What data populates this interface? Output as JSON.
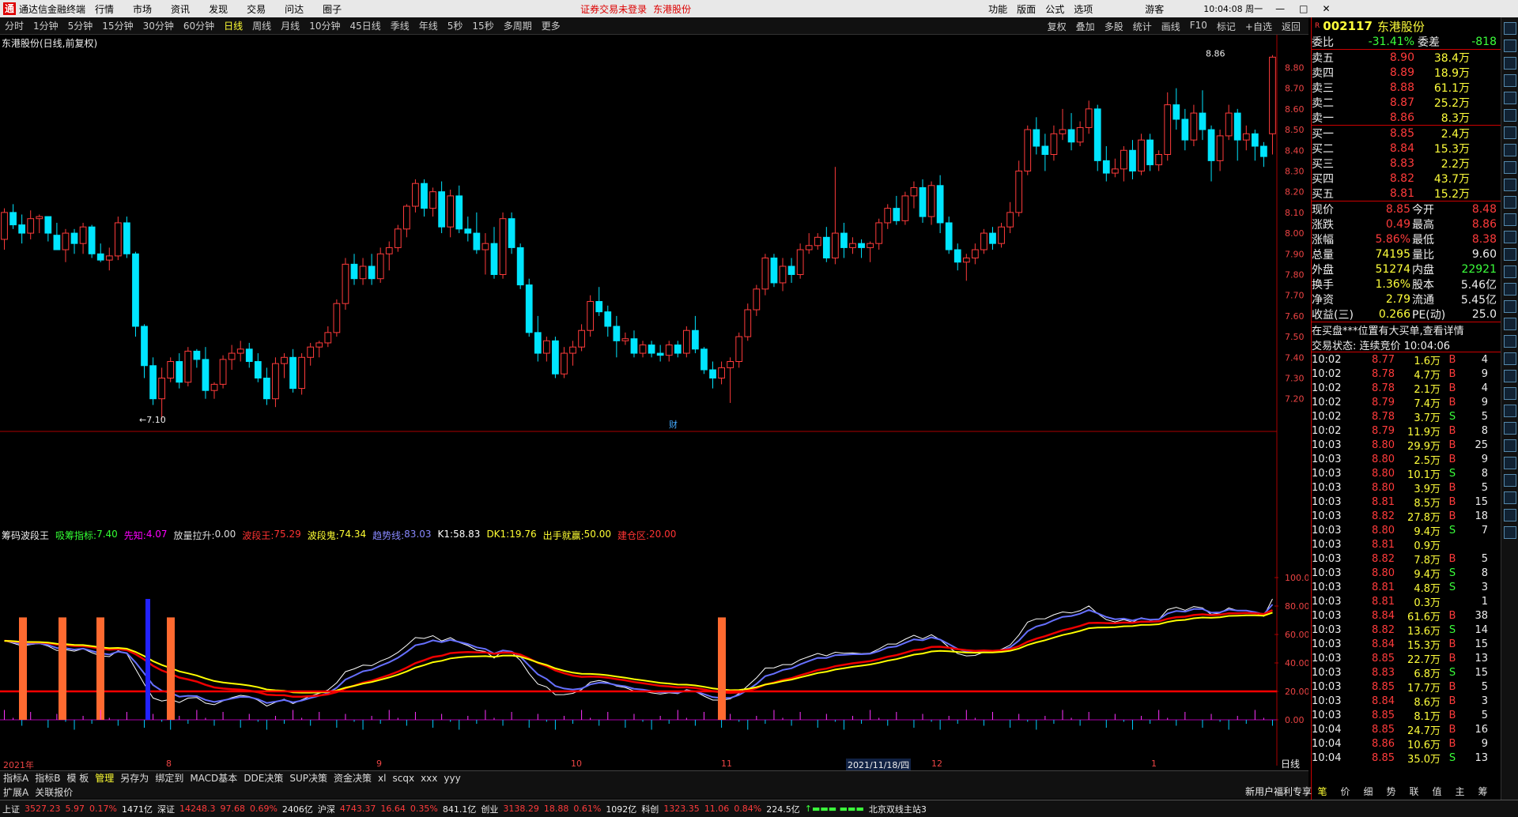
{
  "window": {
    "app_title": "通达信金融终端",
    "menus": [
      "行情",
      "市场",
      "资讯",
      "发现",
      "交易",
      "问达",
      "圈子"
    ],
    "notice": "证券交易未登录",
    "notice_stock": "东港股份",
    "right_menus": [
      "功能",
      "版面",
      "公式",
      "选项"
    ],
    "user": "游客",
    "clock": "10:04:08 周一"
  },
  "periods": [
    "分时",
    "1分钟",
    "5分钟",
    "15分钟",
    "30分钟",
    "60分钟",
    "日线",
    "周线",
    "月线",
    "10分钟",
    "45日线",
    "季线",
    "年线",
    "5秒",
    "15秒",
    "多周期",
    "更多"
  ],
  "active_period": "日线",
  "chart_tools": [
    "复权",
    "叠加",
    "多股",
    "统计",
    "画线",
    "F10",
    "标记",
    "+自选",
    "返回"
  ],
  "chart_title": "东港股份(日线,前复权)",
  "price_high_label": "8.86",
  "price_low_label": "7.10",
  "cai_label": "财",
  "price_axis": [
    "8.80",
    "8.70",
    "8.60",
    "8.50",
    "8.40",
    "8.30",
    "8.20",
    "8.10",
    "8.00",
    "7.90",
    "7.80",
    "7.70",
    "7.60",
    "7.50",
    "7.40",
    "7.30",
    "7.20"
  ],
  "indicator": {
    "name": "筹码波段王",
    "items": [
      {
        "k": "吸筹指标:",
        "v": "7.40",
        "c": "#3f3"
      },
      {
        "k": "先知:",
        "v": "4.07",
        "c": "#f0f"
      },
      {
        "k": "放量拉升:",
        "v": "0.00",
        "c": "#ddd"
      },
      {
        "k": "波段王:",
        "v": "75.29",
        "c": "#f33"
      },
      {
        "k": "波段鬼:",
        "v": "74.34",
        "c": "#ff3"
      },
      {
        "k": "趋势线:",
        "v": "83.03",
        "c": "#88f"
      },
      {
        "k": "K1:",
        "v": "58.83",
        "c": "#fff"
      },
      {
        "k": "DK1:",
        "v": "19.76",
        "c": "#ff3"
      },
      {
        "k": "出手就赢:",
        "v": "50.00",
        "c": "#ff3"
      },
      {
        "k": "建仓区:",
        "v": "20.00",
        "c": "#f33"
      }
    ]
  },
  "ind_axis": [
    "100.0",
    "80.00",
    "60.00",
    "40.00",
    "20.00",
    "0.00"
  ],
  "date_axis": [
    "2021年",
    "8",
    "9",
    "10",
    "11",
    "12",
    "1"
  ],
  "cursor_date": "2021/11/18/四",
  "period_label": "日线",
  "bottom_tabs": [
    "指标A",
    "指标B",
    "模 板",
    "管理",
    "另存为",
    "绑定到",
    "MACD基本",
    "DDE决策",
    "SUP决策",
    "资金决策",
    "xl",
    "scqx",
    "xxx",
    "yyy"
  ],
  "active_bottom_tab": "管理",
  "tabs2": [
    "扩展A",
    "关联报价"
  ],
  "quote": {
    "code": "002117",
    "name": "东港股份",
    "weibi_label": "委比",
    "weibi": "-31.41%",
    "weicha_label": "委差",
    "weicha": "-818",
    "asks": [
      {
        "l": "卖五",
        "p": "8.90",
        "v": "38.4万"
      },
      {
        "l": "卖四",
        "p": "8.89",
        "v": "18.9万"
      },
      {
        "l": "卖三",
        "p": "8.88",
        "v": "61.1万"
      },
      {
        "l": "卖二",
        "p": "8.87",
        "v": "25.2万"
      },
      {
        "l": "卖一",
        "p": "8.86",
        "v": "8.3万"
      }
    ],
    "bids": [
      {
        "l": "买一",
        "p": "8.85",
        "v": "2.4万"
      },
      {
        "l": "买二",
        "p": "8.84",
        "v": "15.3万"
      },
      {
        "l": "买三",
        "p": "8.83",
        "v": "2.2万"
      },
      {
        "l": "买四",
        "p": "8.82",
        "v": "43.7万"
      },
      {
        "l": "买五",
        "p": "8.81",
        "v": "15.2万"
      }
    ],
    "stats": [
      [
        "现价",
        "8.85",
        "今开",
        "8.48"
      ],
      [
        "涨跌",
        "0.49",
        "最高",
        "8.86"
      ],
      [
        "涨幅",
        "5.86%",
        "最低",
        "8.38"
      ],
      [
        "总量",
        "74195",
        "量比",
        "9.60"
      ],
      [
        "外盘",
        "51274",
        "内盘",
        "22921"
      ],
      [
        "换手",
        "1.36%",
        "股本",
        "5.46亿"
      ],
      [
        "净资",
        "2.79",
        "流通",
        "5.45亿"
      ],
      [
        "收益(三)",
        "0.266",
        "PE(动)",
        "25.0"
      ]
    ],
    "note": "在买盘***位置有大买单,查看详情",
    "status": "交易状态: 连续竞价 10:04:06",
    "ticks": [
      [
        "10:02",
        "8.77",
        "1.6万",
        "B",
        "4"
      ],
      [
        "10:02",
        "8.78",
        "4.7万",
        "B",
        "9"
      ],
      [
        "10:02",
        "8.78",
        "2.1万",
        "B",
        "4"
      ],
      [
        "10:02",
        "8.79",
        "7.4万",
        "B",
        "9"
      ],
      [
        "10:02",
        "8.78",
        "3.7万",
        "S",
        "5"
      ],
      [
        "10:02",
        "8.79",
        "11.9万",
        "B",
        "8"
      ],
      [
        "10:03",
        "8.80",
        "29.9万",
        "B",
        "25"
      ],
      [
        "10:03",
        "8.80",
        "2.5万",
        "B",
        "9"
      ],
      [
        "10:03",
        "8.80",
        "10.1万",
        "S",
        "8"
      ],
      [
        "10:03",
        "8.80",
        "3.9万",
        "B",
        "5"
      ],
      [
        "10:03",
        "8.81",
        "8.5万",
        "B",
        "15"
      ],
      [
        "10:03",
        "8.82",
        "27.8万",
        "B",
        "18"
      ],
      [
        "10:03",
        "8.80",
        "9.4万",
        "S",
        "7"
      ],
      [
        "10:03",
        "8.81",
        "0.9万",
        "",
        ""
      ],
      [
        "10:03",
        "8.82",
        "7.8万",
        "B",
        "5"
      ],
      [
        "10:03",
        "8.80",
        "9.4万",
        "S",
        "8"
      ],
      [
        "10:03",
        "8.81",
        "4.8万",
        "S",
        "3"
      ],
      [
        "10:03",
        "8.81",
        "0.3万",
        "",
        "1"
      ],
      [
        "10:03",
        "8.84",
        "61.6万",
        "B",
        "38"
      ],
      [
        "10:03",
        "8.82",
        "13.6万",
        "S",
        "14"
      ],
      [
        "10:03",
        "8.84",
        "15.3万",
        "B",
        "15"
      ],
      [
        "10:03",
        "8.85",
        "22.7万",
        "B",
        "13"
      ],
      [
        "10:03",
        "8.83",
        "6.8万",
        "S",
        "15"
      ],
      [
        "10:03",
        "8.85",
        "17.7万",
        "B",
        "5"
      ],
      [
        "10:03",
        "8.84",
        "8.6万",
        "B",
        "3"
      ],
      [
        "10:03",
        "8.85",
        "8.1万",
        "B",
        "5"
      ],
      [
        "10:04",
        "8.85",
        "24.7万",
        "B",
        "16"
      ],
      [
        "10:04",
        "8.86",
        "10.6万",
        "B",
        "9"
      ],
      [
        "10:04",
        "8.85",
        "35.0万",
        "S",
        "13"
      ]
    ]
  },
  "quote_tabs": [
    "笔",
    "价",
    "细",
    "势",
    "联",
    "值",
    "主",
    "筹"
  ],
  "status": [
    {
      "n": "上证",
      "p": "3527.23",
      "c": "5.97",
      "r": "0.17%",
      "v": "1471亿"
    },
    {
      "n": "深证",
      "p": "14248.3",
      "c": "97.68",
      "r": "0.69%",
      "v": "2406亿"
    },
    {
      "n": "沪深",
      "p": "4743.37",
      "c": "16.64",
      "r": "0.35%",
      "v": "841.1亿"
    },
    {
      "n": "创业",
      "p": "3138.29",
      "c": "18.88",
      "r": "0.61%",
      "v": "1092亿"
    },
    {
      "n": "科创",
      "p": "1323.35",
      "c": "11.06",
      "r": "0.84%",
      "v": "224.5亿"
    }
  ],
  "server": "北京双线主站3",
  "welfare": "新用户福利专享",
  "candles": [
    [
      7.97,
      8.12,
      7.92,
      8.1
    ],
    [
      8.1,
      8.14,
      8.02,
      8.04
    ],
    [
      8.04,
      8.09,
      7.95,
      8.0
    ],
    [
      8.0,
      8.11,
      7.97,
      8.07
    ],
    [
      8.07,
      8.09,
      8.0,
      8.08
    ],
    [
      8.08,
      8.08,
      7.96,
      8.0
    ],
    [
      7.99,
      8.05,
      7.92,
      7.92
    ],
    [
      7.92,
      8.02,
      7.86,
      8.0
    ],
    [
      8.0,
      8.02,
      7.9,
      7.95
    ],
    [
      7.95,
      8.05,
      7.9,
      8.03
    ],
    [
      8.03,
      8.04,
      7.88,
      7.9
    ],
    [
      7.9,
      7.95,
      7.86,
      7.87
    ],
    [
      7.87,
      7.93,
      7.82,
      7.89
    ],
    [
      7.89,
      8.08,
      7.87,
      8.05
    ],
    [
      8.05,
      8.08,
      7.88,
      7.9
    ],
    [
      7.9,
      7.91,
      7.5,
      7.55
    ],
    [
      7.55,
      7.56,
      7.3,
      7.36
    ],
    [
      7.36,
      7.4,
      7.17,
      7.2
    ],
    [
      7.2,
      7.35,
      7.1,
      7.3
    ],
    [
      7.3,
      7.4,
      7.28,
      7.38
    ],
    [
      7.38,
      7.42,
      7.25,
      7.28
    ],
    [
      7.28,
      7.45,
      7.26,
      7.43
    ],
    [
      7.43,
      7.44,
      7.35,
      7.39
    ],
    [
      7.39,
      7.45,
      7.2,
      7.24
    ],
    [
      7.24,
      7.28,
      7.2,
      7.27
    ],
    [
      7.27,
      7.41,
      7.25,
      7.39
    ],
    [
      7.39,
      7.46,
      7.34,
      7.42
    ],
    [
      7.42,
      7.48,
      7.38,
      7.44
    ],
    [
      7.44,
      7.47,
      7.35,
      7.38
    ],
    [
      7.38,
      7.42,
      7.28,
      7.3
    ],
    [
      7.3,
      7.35,
      7.17,
      7.2
    ],
    [
      7.2,
      7.4,
      7.16,
      7.37
    ],
    [
      7.37,
      7.42,
      7.3,
      7.4
    ],
    [
      7.4,
      7.44,
      7.23,
      7.25
    ],
    [
      7.25,
      7.42,
      7.22,
      7.4
    ],
    [
      7.4,
      7.47,
      7.36,
      7.45
    ],
    [
      7.45,
      7.48,
      7.4,
      7.47
    ],
    [
      7.47,
      7.55,
      7.45,
      7.52
    ],
    [
      7.52,
      7.68,
      7.5,
      7.66
    ],
    [
      7.66,
      7.88,
      7.63,
      7.85
    ],
    [
      7.85,
      7.9,
      7.75,
      7.78
    ],
    [
      7.78,
      7.88,
      7.75,
      7.84
    ],
    [
      7.84,
      7.9,
      7.75,
      7.78
    ],
    [
      7.78,
      7.93,
      7.76,
      7.9
    ],
    [
      7.9,
      7.96,
      7.82,
      7.93
    ],
    [
      7.93,
      8.04,
      7.91,
      8.02
    ],
    [
      8.02,
      8.14,
      7.98,
      8.13
    ],
    [
      8.13,
      8.26,
      8.1,
      8.24
    ],
    [
      8.24,
      8.26,
      8.08,
      8.12
    ],
    [
      8.12,
      8.22,
      8.08,
      8.2
    ],
    [
      8.2,
      8.25,
      8.0,
      8.03
    ],
    [
      8.03,
      8.21,
      7.98,
      8.18
    ],
    [
      8.18,
      8.23,
      8.0,
      8.02
    ],
    [
      8.02,
      8.08,
      7.96,
      8.0
    ],
    [
      8.0,
      8.1,
      7.9,
      7.92
    ],
    [
      7.92,
      8.0,
      7.8,
      7.95
    ],
    [
      7.95,
      8.03,
      7.78,
      7.8
    ],
    [
      7.8,
      8.1,
      7.78,
      8.07
    ],
    [
      8.07,
      8.1,
      7.9,
      7.93
    ],
    [
      7.93,
      7.95,
      7.73,
      7.75
    ],
    [
      7.75,
      7.78,
      7.5,
      7.52
    ],
    [
      7.52,
      7.6,
      7.38,
      7.42
    ],
    [
      7.42,
      7.5,
      7.38,
      7.48
    ],
    [
      7.48,
      7.5,
      7.3,
      7.32
    ],
    [
      7.32,
      7.45,
      7.3,
      7.42
    ],
    [
      7.42,
      7.48,
      7.36,
      7.45
    ],
    [
      7.45,
      7.56,
      7.43,
      7.53
    ],
    [
      7.53,
      7.7,
      7.5,
      7.67
    ],
    [
      7.67,
      7.74,
      7.6,
      7.62
    ],
    [
      7.62,
      7.65,
      7.5,
      7.55
    ],
    [
      7.55,
      7.6,
      7.4,
      7.48
    ],
    [
      7.48,
      7.52,
      7.46,
      7.49
    ],
    [
      7.49,
      7.53,
      7.4,
      7.42
    ],
    [
      7.42,
      7.48,
      7.4,
      7.46
    ],
    [
      7.46,
      7.48,
      7.4,
      7.42
    ],
    [
      7.42,
      7.46,
      7.38,
      7.41
    ],
    [
      7.41,
      7.48,
      7.38,
      7.46
    ],
    [
      7.46,
      7.48,
      7.4,
      7.42
    ],
    [
      7.42,
      7.55,
      7.4,
      7.53
    ],
    [
      7.53,
      7.6,
      7.42,
      7.44
    ],
    [
      7.44,
      7.45,
      7.32,
      7.34
    ],
    [
      7.34,
      7.38,
      7.25,
      7.3
    ],
    [
      7.3,
      7.38,
      7.27,
      7.35
    ],
    [
      7.35,
      7.4,
      7.18,
      7.38
    ],
    [
      7.38,
      7.52,
      7.35,
      7.5
    ],
    [
      7.5,
      7.66,
      7.48,
      7.63
    ],
    [
      7.63,
      7.75,
      7.6,
      7.73
    ],
    [
      7.73,
      7.9,
      7.7,
      7.88
    ],
    [
      7.88,
      7.9,
      7.74,
      7.76
    ],
    [
      7.76,
      7.88,
      7.72,
      7.84
    ],
    [
      7.84,
      7.88,
      7.76,
      7.8
    ],
    [
      7.8,
      7.95,
      7.78,
      7.92
    ],
    [
      7.92,
      8.0,
      7.9,
      7.94
    ],
    [
      7.94,
      8.0,
      7.92,
      7.98
    ],
    [
      7.98,
      8.03,
      7.86,
      7.88
    ],
    [
      7.88,
      8.32,
      7.85,
      8.0
    ],
    [
      8.0,
      8.05,
      7.88,
      7.93
    ],
    [
      7.93,
      7.98,
      7.9,
      7.95
    ],
    [
      7.95,
      7.97,
      7.88,
      7.93
    ],
    [
      7.93,
      7.96,
      7.86,
      7.95
    ],
    [
      7.95,
      8.07,
      7.92,
      8.05
    ],
    [
      8.05,
      8.14,
      8.02,
      8.12
    ],
    [
      8.12,
      8.18,
      8.04,
      8.06
    ],
    [
      8.06,
      8.2,
      8.04,
      8.18
    ],
    [
      8.18,
      8.25,
      8.12,
      8.22
    ],
    [
      8.22,
      8.26,
      8.05,
      8.08
    ],
    [
      8.08,
      8.25,
      8.04,
      8.23
    ],
    [
      8.23,
      8.28,
      8.0,
      8.05
    ],
    [
      8.05,
      8.08,
      7.9,
      7.92
    ],
    [
      7.92,
      7.95,
      7.82,
      7.86
    ],
    [
      7.86,
      7.9,
      7.77,
      7.88
    ],
    [
      7.88,
      7.95,
      7.85,
      7.92
    ],
    [
      7.92,
      8.02,
      7.9,
      8.0
    ],
    [
      8.0,
      8.03,
      7.92,
      7.95
    ],
    [
      7.95,
      8.05,
      7.93,
      8.03
    ],
    [
      8.03,
      8.15,
      8.0,
      8.1
    ],
    [
      8.1,
      8.35,
      8.08,
      8.3
    ],
    [
      8.3,
      8.52,
      8.28,
      8.5
    ],
    [
      8.5,
      8.56,
      8.38,
      8.42
    ],
    [
      8.42,
      8.48,
      8.3,
      8.38
    ],
    [
      8.38,
      8.52,
      8.35,
      8.48
    ],
    [
      8.48,
      8.6,
      8.45,
      8.5
    ],
    [
      8.5,
      8.58,
      8.4,
      8.44
    ],
    [
      8.44,
      8.54,
      8.42,
      8.51
    ],
    [
      8.51,
      8.64,
      8.48,
      8.6
    ],
    [
      8.6,
      8.62,
      8.3,
      8.35
    ],
    [
      8.35,
      8.42,
      8.25,
      8.29
    ],
    [
      8.29,
      8.36,
      8.27,
      8.31
    ],
    [
      8.31,
      8.42,
      8.25,
      8.4
    ],
    [
      8.4,
      8.45,
      8.26,
      8.3
    ],
    [
      8.3,
      8.48,
      8.28,
      8.45
    ],
    [
      8.45,
      8.48,
      8.3,
      8.33
    ],
    [
      8.33,
      8.4,
      8.3,
      8.38
    ],
    [
      8.38,
      8.68,
      8.35,
      8.62
    ],
    [
      8.62,
      8.7,
      8.5,
      8.55
    ],
    [
      8.55,
      8.6,
      8.4,
      8.45
    ],
    [
      8.45,
      8.62,
      8.42,
      8.58
    ],
    [
      8.58,
      8.69,
      8.45,
      8.5
    ],
    [
      8.5,
      8.52,
      8.25,
      8.35
    ],
    [
      8.35,
      8.5,
      8.3,
      8.47
    ],
    [
      8.47,
      8.62,
      8.45,
      8.58
    ],
    [
      8.58,
      8.6,
      8.35,
      8.45
    ],
    [
      8.45,
      8.52,
      8.4,
      8.48
    ],
    [
      8.48,
      8.5,
      8.35,
      8.42
    ],
    [
      8.42,
      8.44,
      8.32,
      8.37
    ],
    [
      8.48,
      8.86,
      8.38,
      8.85
    ]
  ]
}
